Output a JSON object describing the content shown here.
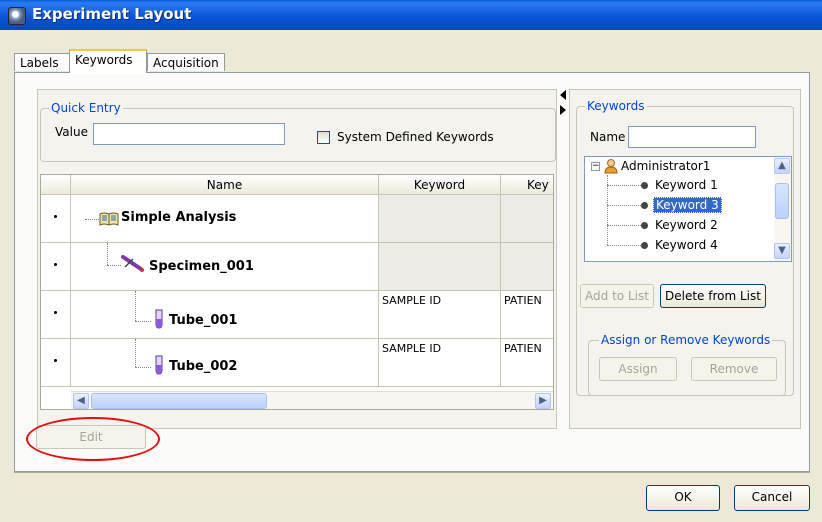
{
  "window": {
    "title": "Experiment Layout"
  },
  "tabs": [
    {
      "label": "Labels",
      "active": false
    },
    {
      "label": "Keywords",
      "active": true
    },
    {
      "label": "Acquisition",
      "active": false
    }
  ],
  "quick_entry": {
    "legend": "Quick Entry",
    "value_label": "Value",
    "value": "",
    "system_defined_label": "System Defined Keywords",
    "system_defined_checked": false
  },
  "grid": {
    "columns": [
      "Name",
      "Keyword",
      "Key"
    ],
    "rows": [
      {
        "name": "Simple Analysis",
        "icon": "book-icon",
        "keyword": "",
        "key": ""
      },
      {
        "name": "Specimen_001",
        "icon": "specimen-icon",
        "keyword": "",
        "key": ""
      },
      {
        "name": "Tube_001",
        "icon": "tube-icon",
        "keyword": "SAMPLE ID",
        "key": "PATIEN"
      },
      {
        "name": "Tube_002",
        "icon": "tube-icon",
        "keyword": "SAMPLE ID",
        "key": "PATIEN"
      }
    ]
  },
  "edit_button": {
    "label": "Edit",
    "enabled": false
  },
  "keywords_panel": {
    "legend": "Keywords",
    "name_label": "Name",
    "name_value": "",
    "tree": {
      "root": "Administrator1",
      "items": [
        "Keyword 1",
        "Keyword 3",
        "Keyword 2",
        "Keyword 4"
      ],
      "selected": "Keyword 3"
    },
    "add_to_list": "Add to List",
    "delete_from_list": "Delete from List",
    "assign_group_legend": "Assign or Remove Keywords",
    "assign": "Assign",
    "remove": "Remove"
  },
  "footer": {
    "ok": "OK",
    "cancel": "Cancel"
  },
  "colors": {
    "titlebar": "#0a5fd8",
    "legend": "#0046d5",
    "selection": "#316ac5",
    "highlight_circle": "#e01010"
  }
}
